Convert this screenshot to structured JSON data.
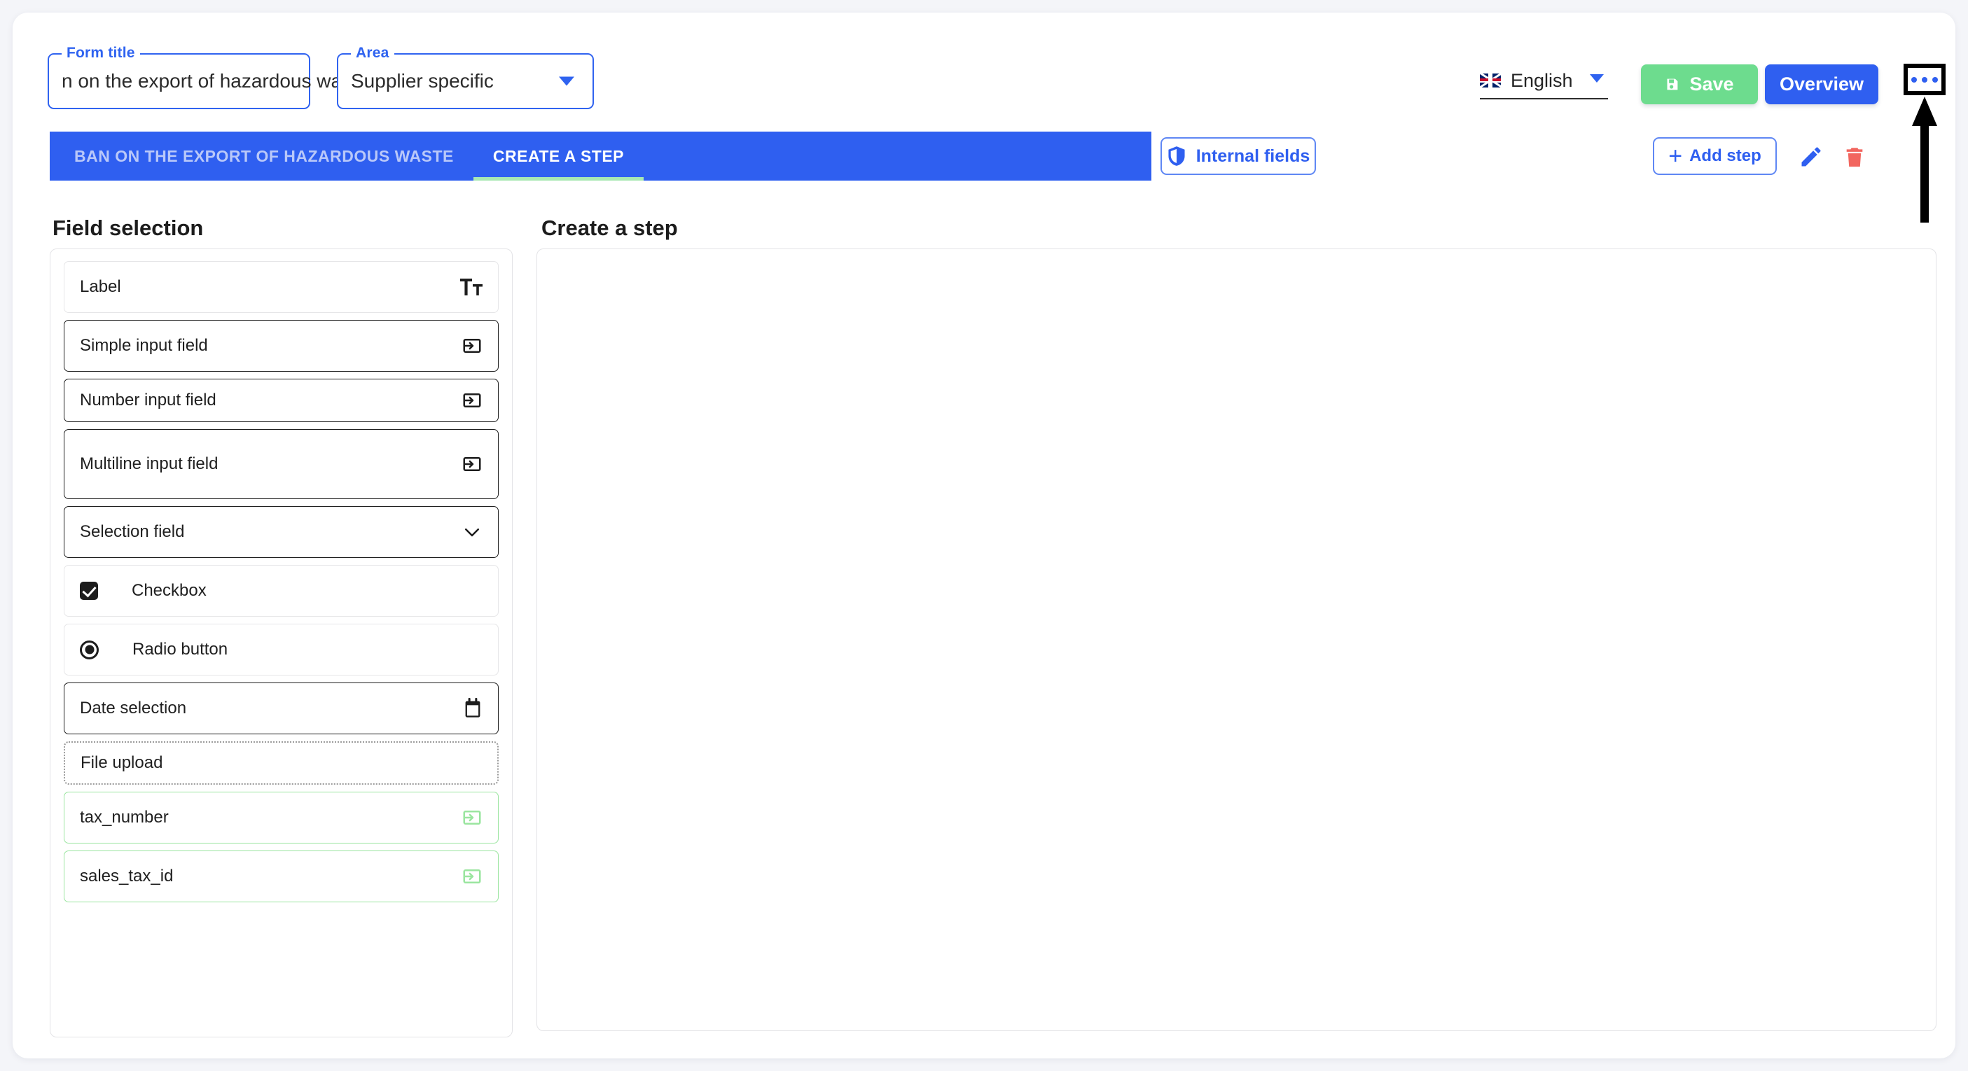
{
  "toolbar": {
    "form_title": {
      "legend": "Form title",
      "value": "n on the export of hazardous waste"
    },
    "area": {
      "legend": "Area",
      "value": "Supplier specific"
    },
    "language": {
      "label": "English",
      "flag": "uk-flag-icon"
    },
    "save_label": "Save",
    "overview_label": "Overview",
    "more_menu_label": "..."
  },
  "tabs": [
    {
      "label": "BAN ON THE EXPORT OF HAZARDOUS WASTE",
      "active": false
    },
    {
      "label": "CREATE A STEP",
      "active": true
    }
  ],
  "actions": {
    "internal_fields_label": "Internal fields",
    "add_step_label": "Add step",
    "edit_label": "Edit",
    "delete_label": "Delete"
  },
  "left_panel": {
    "title": "Field selection",
    "items": [
      {
        "label": "Label",
        "icon": "text-format-icon",
        "style": "light",
        "size": "h-100"
      },
      {
        "label": "Simple input field",
        "icon": "input-field-icon",
        "style": "dark",
        "size": "h-100"
      },
      {
        "label": "Number input field",
        "icon": "input-field-icon",
        "style": "dark",
        "size": "h-80"
      },
      {
        "label": "Multiline input field",
        "icon": "input-field-icon",
        "style": "dark",
        "size": "h-130"
      },
      {
        "label": "Selection field",
        "icon": "chevron-down-icon",
        "style": "dark",
        "size": "h-100"
      },
      {
        "label": "Checkbox",
        "icon": "checkbox-icon",
        "style": "light",
        "size": "h-100"
      },
      {
        "label": "Radio button",
        "icon": "radio-icon",
        "style": "light",
        "size": "h-100"
      },
      {
        "label": "Date selection",
        "icon": "calendar-icon",
        "style": "dark",
        "size": "h-100"
      },
      {
        "label": "File upload",
        "icon": "none",
        "style": "dotted",
        "size": "h-80"
      },
      {
        "label": "tax_number",
        "icon": "input-field-icon-green",
        "style": "green",
        "size": "h-100"
      },
      {
        "label": "sales_tax_id",
        "icon": "input-field-icon-green",
        "style": "green",
        "size": "h-100"
      }
    ]
  },
  "right_panel": {
    "title": "Create a step"
  },
  "colors": {
    "primary_blue": "#2f5ff0",
    "save_green": "#6ddc8e",
    "tab_underline_green": "#a8e8b2",
    "green_field_border": "#9ae59f",
    "delete_red": "#f2665f",
    "page_bg": "#f4f5f9"
  }
}
